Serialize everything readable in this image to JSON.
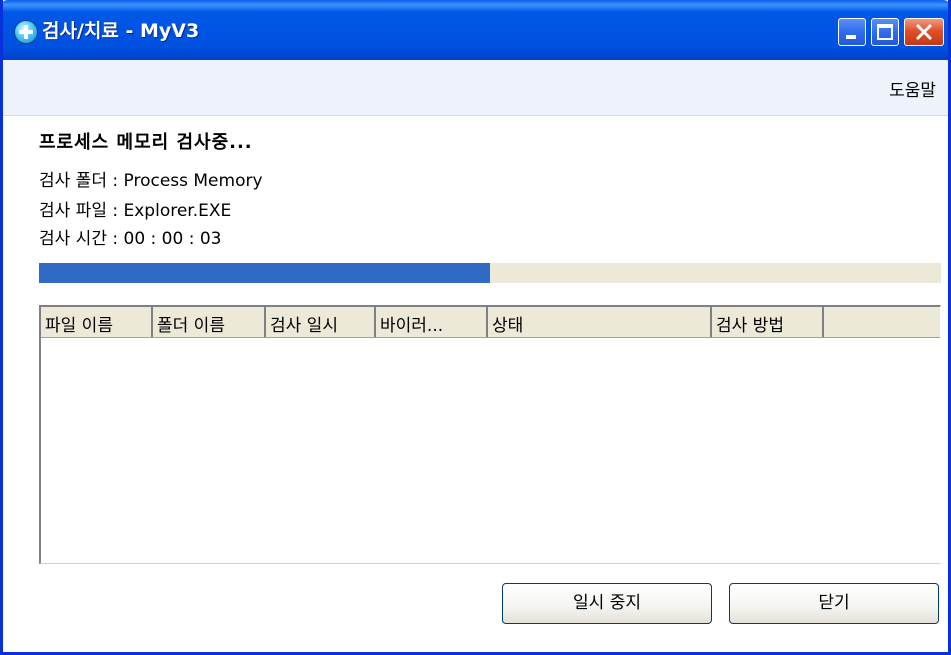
{
  "window": {
    "title": "검사/치료 - MyV3",
    "app_icon": "plus-circle-icon",
    "controls": {
      "minimize_icon": "minimize-icon",
      "maximize_icon": "maximize-icon",
      "close_icon": "close-icon"
    }
  },
  "menubar": {
    "help_label": "도움말"
  },
  "scan": {
    "heading": "프로세스 메모리 검사중...",
    "folder_line": "검사 폴더 : Process Memory",
    "file_line": "검사 파일 : Explorer.EXE",
    "time_line": "검사 시간 : 00 : 00 : 03",
    "progress_fraction": 0.5,
    "progress_color": "#316ac5"
  },
  "results_table": {
    "columns": [
      "파일 이름",
      "폴더 이름",
      "검사 일시",
      "바이러...",
      "상태",
      "검사 방법"
    ],
    "rows": []
  },
  "buttons": {
    "pause_label": "일시 중지",
    "close_label": "닫기"
  },
  "colors": {
    "titlebar": "#0054e3",
    "window_border": "#0831d9",
    "menubar_bg": "#edf2fb",
    "close_button": "#e0512b"
  }
}
